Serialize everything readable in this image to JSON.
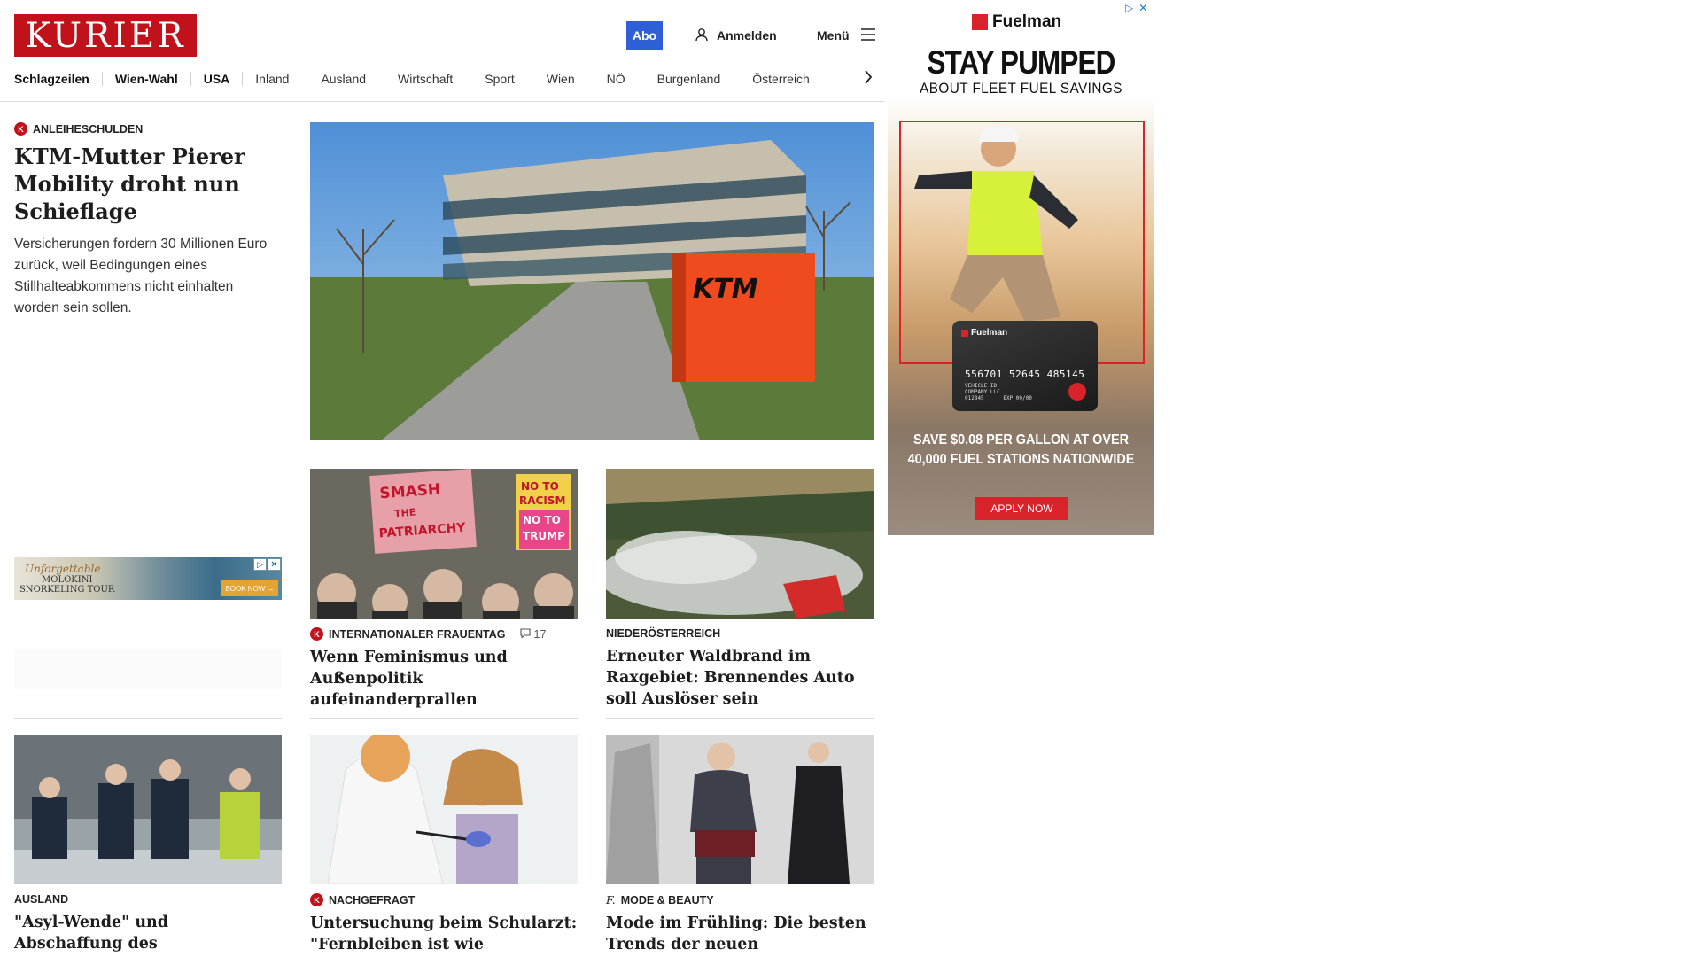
{
  "header": {
    "logo_text": "KURIER",
    "abo_label": "Abo",
    "login_label": "Anmelden",
    "menu_label": "Menü"
  },
  "nav": {
    "items": [
      {
        "label": "Schlagzeilen"
      },
      {
        "label": "Wien-Wahl"
      },
      {
        "label": "USA"
      },
      {
        "label": "Inland"
      },
      {
        "label": "Ausland"
      },
      {
        "label": "Wirtschaft"
      },
      {
        "label": "Sport"
      },
      {
        "label": "Wien"
      },
      {
        "label": "NÖ"
      },
      {
        "label": "Burgenland"
      },
      {
        "label": "Österreich"
      }
    ]
  },
  "lead": {
    "kicker": "ANLEIHESCHULDEN",
    "title": "KTM-Mutter Pierer Mobility droht nun Schieflage",
    "text": "Versicherungen fordern 30 Millionen Euro zurück, weil Bedingungen eines Stillhalteabkommens nicht einhalten worden sein sollen.",
    "image_sign": "KTM"
  },
  "small_ad": {
    "line1": "Unforgettable",
    "line2": "MOLOKINI",
    "line3": "SNORKELING TOUR",
    "cta": "BOOK NOW →"
  },
  "cards": [
    {
      "kicker": "INTERNATIONALER FRAUENTAG",
      "comments": "17",
      "title": "Wenn Feminismus und Außenpolitik aufeinanderprallen",
      "badge": "K",
      "sign1": "SMASH THE PATRIARCHY",
      "sign2": "NO TO RACISM NO TO TRUMP"
    },
    {
      "kicker": "NIEDERÖSTERREICH",
      "title": "Erneuter Waldbrand im Raxgebiet: Brennendes Auto soll Auslöser sein"
    },
    {
      "kicker": "AUSLAND",
      "title": "\"Asyl-Wende\" und Abschaffung des Bürgergeldes: Einigung bei CDU und SPD"
    },
    {
      "kicker": "NACHGEFRAGT",
      "title": "Untersuchung beim Schularzt: \"Fernbleiben ist wie Schuleschwänzen\"",
      "badge": "K"
    },
    {
      "kicker": "MODE & BEAUTY",
      "title": "Mode im Frühling: Die besten Trends der neuen Kollektionen",
      "badge": "f."
    }
  ],
  "right_ad": {
    "brand": "Fuelman",
    "headline": "STAY PUMPED",
    "subheadline": "ABOUT FLEET FUEL SAVINGS",
    "card_brand": "Fuelman",
    "card_number": "556701 52645 485145",
    "card_small": "VEHICLE ID\nCOMPANY LLC\n012345      EXP 00/00",
    "save_text": "SAVE $0.08 PER GALLON AT OVER 40,000 FUEL STATIONS NATIONWIDE",
    "cta": "APPLY NOW"
  },
  "colors": {
    "brand_red": "#c1111a",
    "abo_blue": "#2f5fd4",
    "ad_red": "#d8232a"
  }
}
